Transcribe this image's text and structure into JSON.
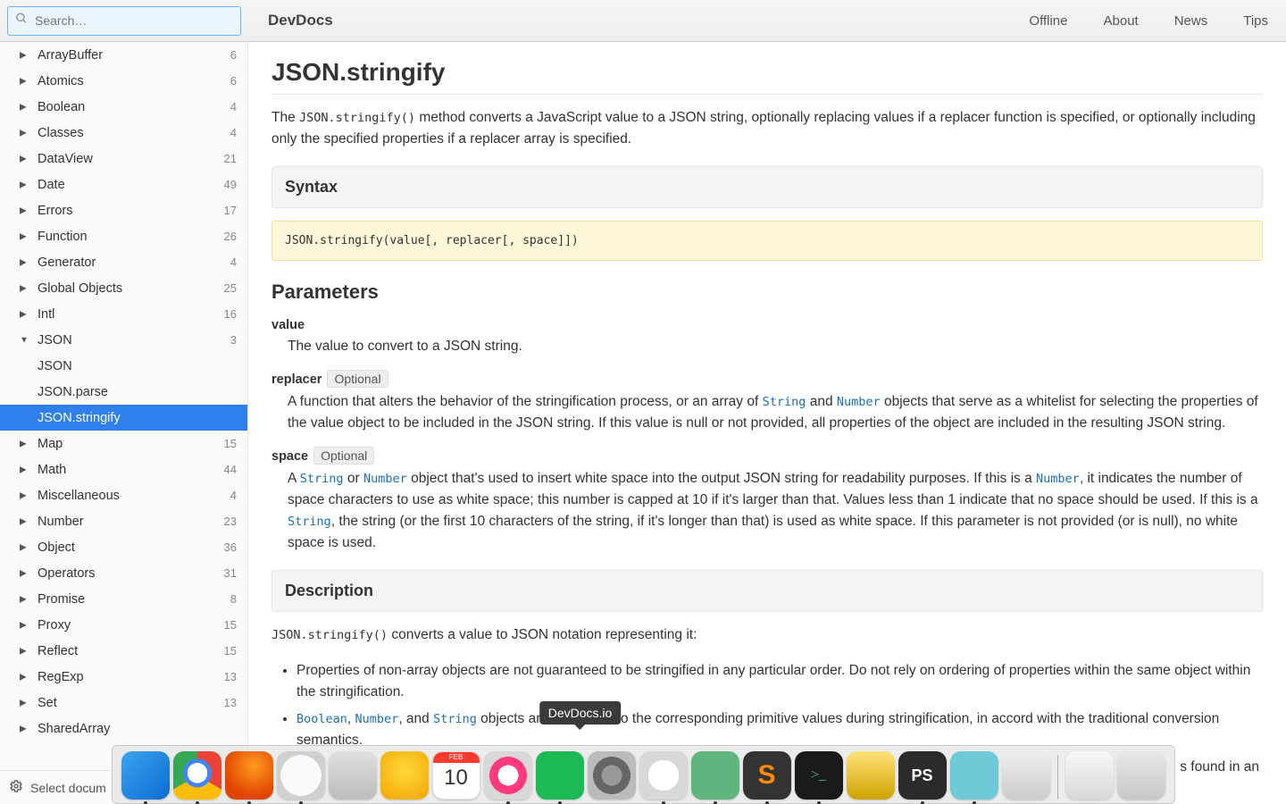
{
  "app": {
    "brand": "DevDocs"
  },
  "search": {
    "placeholder": "Search…"
  },
  "nav": [
    "Offline",
    "About",
    "News",
    "Tips"
  ],
  "sidebar": {
    "items": [
      {
        "label": "ArrayBuffer",
        "count": "6",
        "kind": "cat"
      },
      {
        "label": "Atomics",
        "count": "6",
        "kind": "cat"
      },
      {
        "label": "Boolean",
        "count": "4",
        "kind": "cat"
      },
      {
        "label": "Classes",
        "count": "4",
        "kind": "cat"
      },
      {
        "label": "DataView",
        "count": "21",
        "kind": "cat"
      },
      {
        "label": "Date",
        "count": "49",
        "kind": "cat"
      },
      {
        "label": "Errors",
        "count": "17",
        "kind": "cat"
      },
      {
        "label": "Function",
        "count": "26",
        "kind": "cat"
      },
      {
        "label": "Generator",
        "count": "4",
        "kind": "cat"
      },
      {
        "label": "Global Objects",
        "count": "25",
        "kind": "cat"
      },
      {
        "label": "Intl",
        "count": "16",
        "kind": "cat"
      },
      {
        "label": "JSON",
        "count": "3",
        "kind": "cat",
        "open": true
      },
      {
        "label": "JSON",
        "kind": "sub"
      },
      {
        "label": "JSON.parse",
        "kind": "sub"
      },
      {
        "label": "JSON.stringify",
        "kind": "sub",
        "active": true
      },
      {
        "label": "Map",
        "count": "15",
        "kind": "cat"
      },
      {
        "label": "Math",
        "count": "44",
        "kind": "cat"
      },
      {
        "label": "Miscellaneous",
        "count": "4",
        "kind": "cat"
      },
      {
        "label": "Number",
        "count": "23",
        "kind": "cat"
      },
      {
        "label": "Object",
        "count": "36",
        "kind": "cat"
      },
      {
        "label": "Operators",
        "count": "31",
        "kind": "cat"
      },
      {
        "label": "Promise",
        "count": "8",
        "kind": "cat"
      },
      {
        "label": "Proxy",
        "count": "15",
        "kind": "cat"
      },
      {
        "label": "Reflect",
        "count": "15",
        "kind": "cat"
      },
      {
        "label": "RegExp",
        "count": "13",
        "kind": "cat"
      },
      {
        "label": "Set",
        "count": "13",
        "kind": "cat"
      },
      {
        "label": "SharedArray",
        "count": "",
        "kind": "cat"
      }
    ],
    "footer": "Select docum"
  },
  "doc": {
    "title": "JSON.stringify",
    "intro_pre": "The ",
    "intro_code": "JSON.stringify()",
    "intro_post": " method converts a JavaScript value to a JSON string, optionally replacing values if a replacer function is specified, or optionally including only the specified properties if a replacer array is specified.",
    "syntax_head": "Syntax",
    "syntax_code": "JSON.stringify(value[, replacer[, space]])",
    "params_head": "Parameters",
    "p_value": {
      "name": "value",
      "desc": "The value to convert to a JSON string."
    },
    "p_replacer": {
      "name": "replacer",
      "badge": "Optional",
      "d1": "A function that alters the behavior of the stringification process, or an array of ",
      "c1": "String",
      "d2": " and ",
      "c2": "Number",
      "d3": " objects that serve as a whitelist for selecting the properties of the value object to be included in the JSON string. If this value is null or not provided, all properties of the object are included in the resulting JSON string."
    },
    "p_space": {
      "name": "space",
      "badge": "Optional",
      "d1": "A ",
      "c1": "String",
      "d2": " or ",
      "c2": "Number",
      "d3": " object that's used to insert white space into the output JSON string for readability purposes. If this is a ",
      "c3": "Number",
      "d4": ", it indicates the number of space characters to use as white space; this number is capped at 10 if it's larger than that. Values less than 1 indicate that no space should be used. If this is a ",
      "c4": "String",
      "d5": ", the string (or the first 10 characters of the string, if it's longer than that) is used as white space. If this parameter is not provided (or is null), no white space is used."
    },
    "desc_head": "Description",
    "desc_code": "JSON.stringify()",
    "desc_line": " converts a value to JSON notation representing it:",
    "b1": "Properties of non-array objects are not guaranteed to be stringified in any particular order. Do not rely on ordering of properties within the same object within the stringification.",
    "b2": {
      "c1": "Boolean",
      "s1": ", ",
      "c2": "Number",
      "s2": ", and ",
      "c3": "String",
      "s3": " objects are converted to the corresponding primitive values during stringification, in accord with the traditional conversion semantics."
    },
    "b3": "s found in an"
  },
  "tooltip": "DevDocs.io",
  "dock_running": [
    true,
    true,
    true,
    true,
    false,
    false,
    false,
    true,
    true,
    false,
    true,
    true,
    true,
    true,
    false,
    true,
    true,
    false
  ]
}
